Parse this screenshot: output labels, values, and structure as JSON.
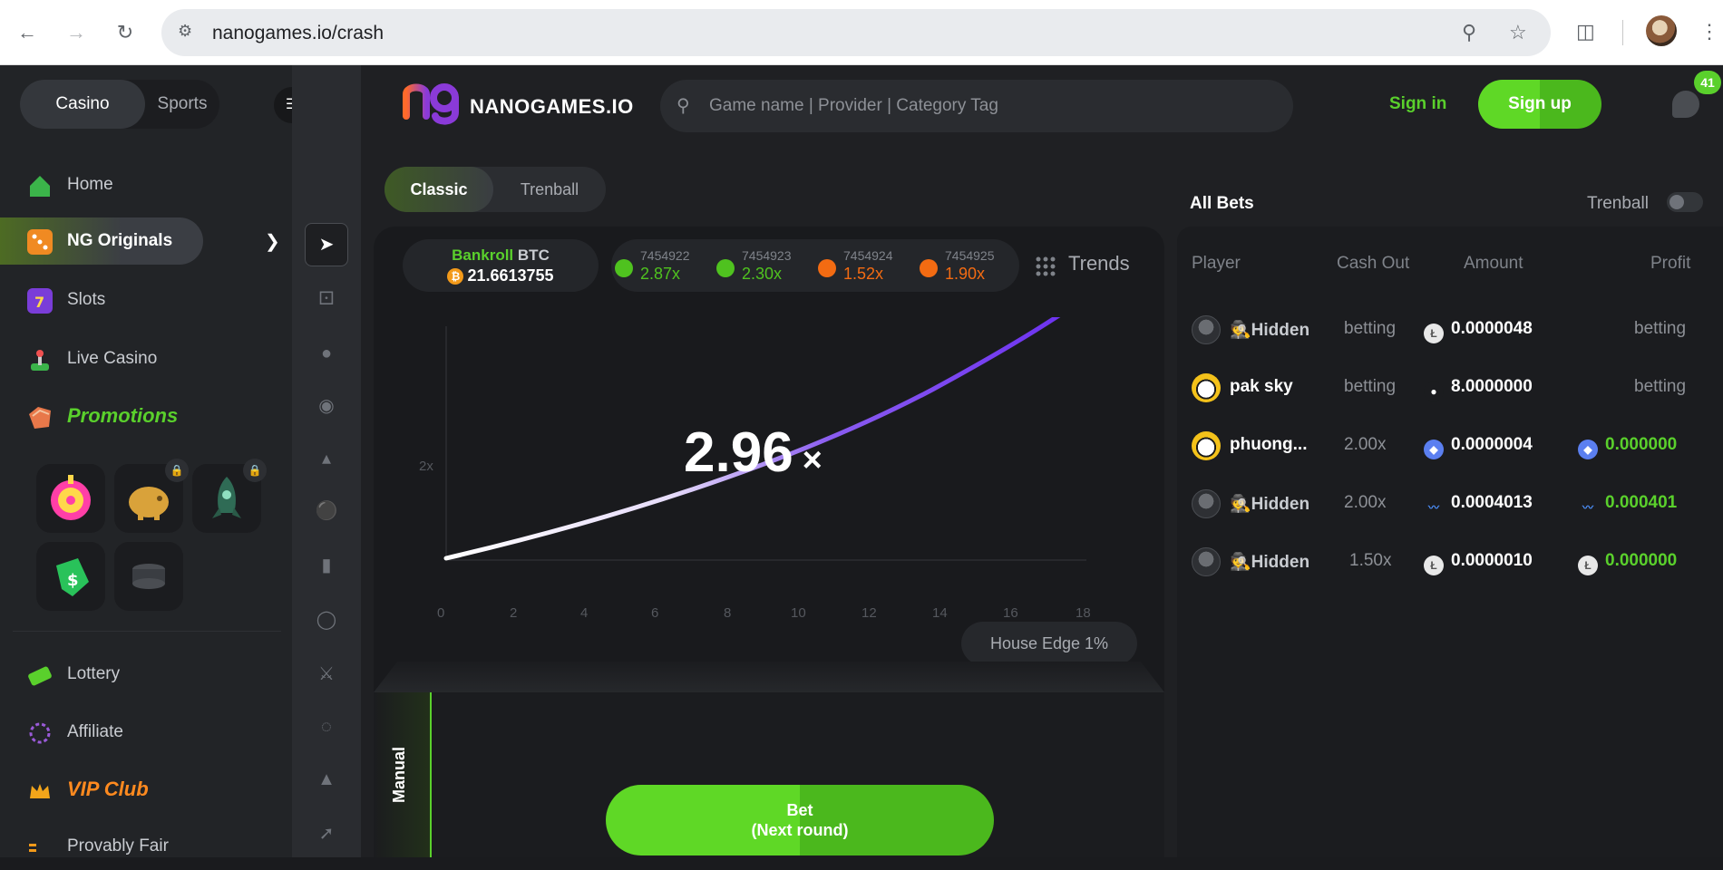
{
  "browser": {
    "url": "nanogames.io/crash"
  },
  "sidebar": {
    "tabs": [
      "Casino",
      "Sports"
    ],
    "menu_icon": "hamburger-icon",
    "items": [
      {
        "label": "Home",
        "icon": "home-icon"
      },
      {
        "label": "NG Originals",
        "icon": "dice-icon"
      },
      {
        "label": "Slots",
        "icon": "slots-icon"
      },
      {
        "label": "Live Casino",
        "icon": "joystick-icon"
      },
      {
        "label": "Promotions",
        "icon": "tag-icon"
      },
      {
        "label": "Lottery",
        "icon": "ticket-icon"
      },
      {
        "label": "Affiliate",
        "icon": "network-icon"
      },
      {
        "label": "VIP Club",
        "icon": "crown-icon"
      },
      {
        "label": "Provably Fair",
        "icon": "shield-icon"
      }
    ]
  },
  "header": {
    "logo_text": "NANOGAMES.IO",
    "search_placeholder": "Game name | Provider | Category Tag",
    "sign_in": "Sign in",
    "sign_up": "Sign up",
    "chat_badge": "41"
  },
  "game": {
    "modes": [
      "Classic",
      "Trenball"
    ],
    "bankroll_label": "Bankroll",
    "bankroll_currency": "BTC",
    "bankroll_value": "21.6613755",
    "history": [
      {
        "id": "7454922",
        "value": "2.87x",
        "color": "#4fc21f"
      },
      {
        "id": "7454923",
        "value": "2.30x",
        "color": "#4fc21f"
      },
      {
        "id": "7454924",
        "value": "1.52x",
        "color": "#f36b12"
      },
      {
        "id": "7454925",
        "value": "1.90x",
        "color": "#f36b12"
      }
    ],
    "trends_label": "Trends",
    "multiplier": "2.96",
    "multiplier_suffix": "×",
    "y_tick": "2x",
    "x_ticks": [
      "0",
      "2",
      "4",
      "6",
      "8",
      "10",
      "12",
      "14",
      "16",
      "18"
    ],
    "house_edge": "House Edge 1%",
    "manual_label": "Manual",
    "bet_button_line1": "Bet",
    "bet_button_line2": "(Next round)"
  },
  "bets": {
    "title": "All Bets",
    "toggle_label": "Trenball",
    "columns": [
      "Player",
      "Cash Out",
      "Amount",
      "Profit"
    ],
    "rows": [
      {
        "player": "Hidden",
        "hidden": true,
        "cashout": "betting",
        "coin": "ltc",
        "amount": "0.0000048",
        "profit": "betting",
        "profit_green": false
      },
      {
        "player": "pak sky",
        "hidden": false,
        "cashout": "betting",
        "coin": "panda",
        "amount": "8.0000000",
        "profit": "betting",
        "profit_green": false
      },
      {
        "player": "phuong...",
        "hidden": false,
        "cashout": "2.00x",
        "coin": "eth",
        "amount": "0.0000004",
        "profit": "0.000000",
        "profit_green": true
      },
      {
        "player": "Hidden",
        "hidden": true,
        "cashout": "2.00x",
        "coin": "wave",
        "amount": "0.0004013",
        "profit": "0.000401",
        "profit_green": true
      },
      {
        "player": "Hidden",
        "hidden": true,
        "cashout": "1.50x",
        "coin": "ltc",
        "amount": "0.0000010",
        "profit": "0.000000",
        "profit_green": true
      }
    ]
  }
}
